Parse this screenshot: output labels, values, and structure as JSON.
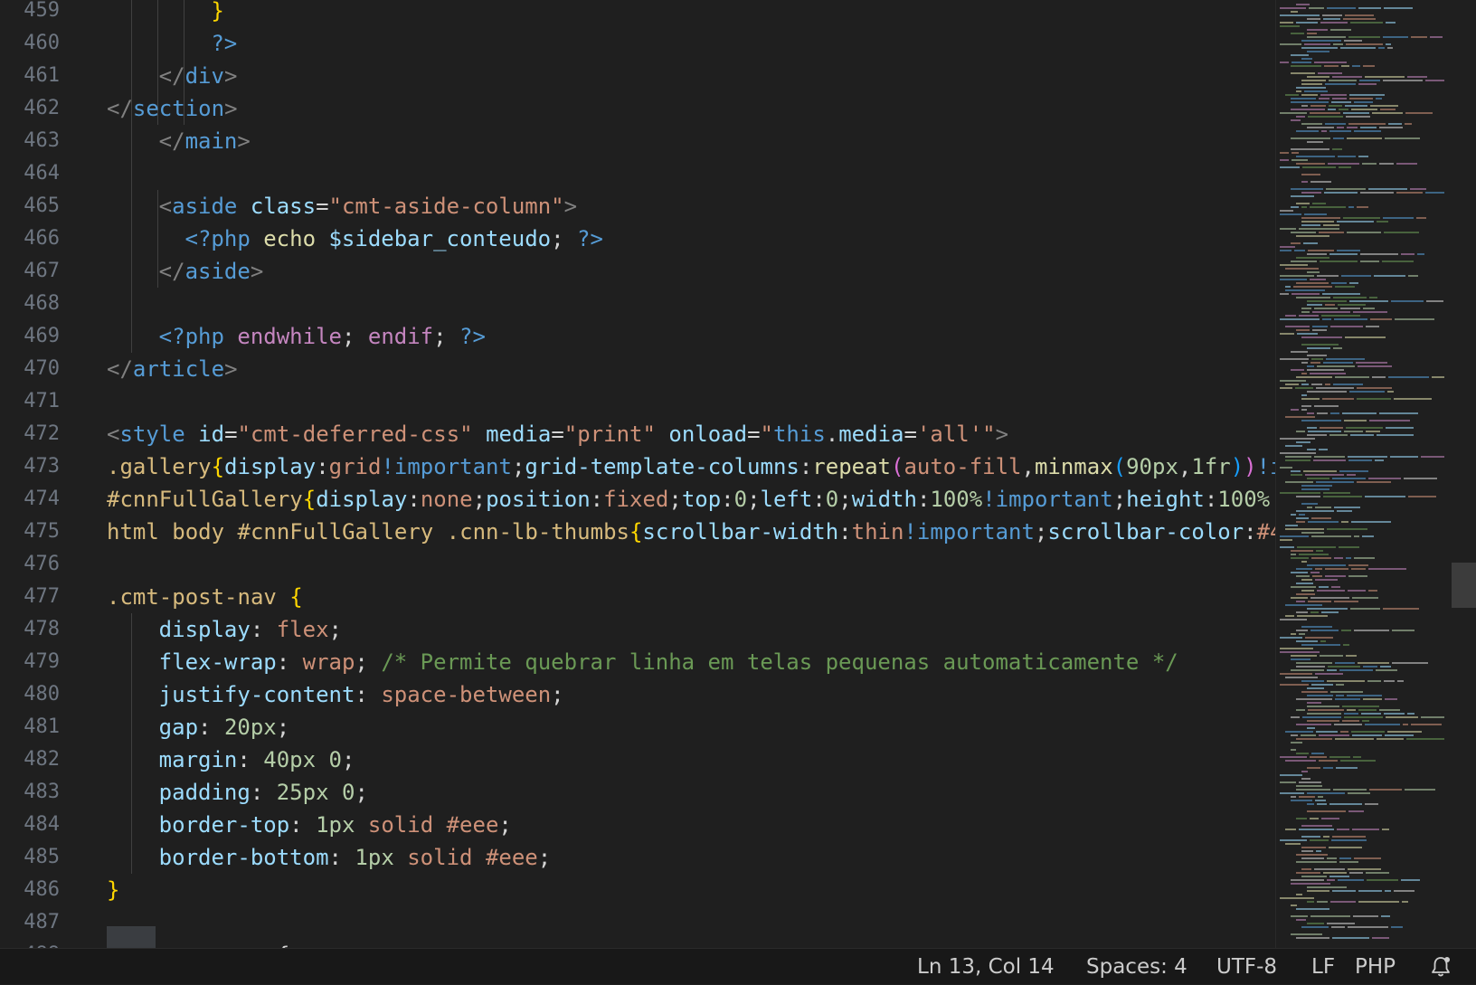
{
  "editor": {
    "line_numbers": [
      "459",
      "460",
      "461",
      "462",
      "463",
      "464",
      "465",
      "466",
      "467",
      "468",
      "469",
      "470",
      "471",
      "472",
      "473",
      "474",
      "475",
      "476",
      "477",
      "478",
      "479",
      "480",
      "481",
      "482",
      "483",
      "484",
      "485",
      "486",
      "487",
      "488"
    ],
    "lines": [
      [
        [
          "t-brace",
          "}"
        ]
      ],
      [
        [
          "t-php",
          "?>"
        ]
      ],
      [
        [
          "t-punc",
          "</"
        ],
        [
          "t-tag",
          "div"
        ],
        [
          "t-punc",
          ">"
        ]
      ],
      [
        [
          "t-punc",
          "</"
        ],
        [
          "t-tag",
          "section"
        ],
        [
          "t-punc",
          ">"
        ]
      ],
      [
        [
          "t-punc",
          "</"
        ],
        [
          "t-tag",
          "main"
        ],
        [
          "t-punc",
          ">"
        ]
      ],
      [],
      [
        [
          "t-punc",
          "<"
        ],
        [
          "t-tag",
          "aside"
        ],
        [
          "t-plain",
          " "
        ],
        [
          "t-attr",
          "class"
        ],
        [
          "t-plain",
          "="
        ],
        [
          "t-str",
          "\"cmt-aside-column\""
        ],
        [
          "t-punc",
          ">"
        ]
      ],
      [
        [
          "t-php",
          "<?php"
        ],
        [
          "t-plain",
          " "
        ],
        [
          "t-fn",
          "echo"
        ],
        [
          "t-plain",
          " "
        ],
        [
          "t-var",
          "$sidebar_conteudo"
        ],
        [
          "t-plain",
          "; "
        ],
        [
          "t-php",
          "?>"
        ]
      ],
      [
        [
          "t-punc",
          "</"
        ],
        [
          "t-tag",
          "aside"
        ],
        [
          "t-punc",
          ">"
        ]
      ],
      [],
      [
        [
          "t-php",
          "<?php"
        ],
        [
          "t-plain",
          " "
        ],
        [
          "t-kw",
          "endwhile"
        ],
        [
          "t-plain",
          "; "
        ],
        [
          "t-kw",
          "endif"
        ],
        [
          "t-plain",
          "; "
        ],
        [
          "t-php",
          "?>"
        ]
      ],
      [
        [
          "t-punc",
          "</"
        ],
        [
          "t-tag",
          "article"
        ],
        [
          "t-punc",
          ">"
        ]
      ],
      [],
      [
        [
          "t-punc",
          "<"
        ],
        [
          "t-tag",
          "style"
        ],
        [
          "t-plain",
          " "
        ],
        [
          "t-attr",
          "id"
        ],
        [
          "t-plain",
          "="
        ],
        [
          "t-str",
          "\"cmt-deferred-css\""
        ],
        [
          "t-plain",
          " "
        ],
        [
          "t-attr",
          "media"
        ],
        [
          "t-plain",
          "="
        ],
        [
          "t-str",
          "\"print\""
        ],
        [
          "t-plain",
          " "
        ],
        [
          "t-attr",
          "onload"
        ],
        [
          "t-plain",
          "="
        ],
        [
          "t-str",
          "\""
        ],
        [
          "t-this",
          "this"
        ],
        [
          "t-plain",
          "."
        ],
        [
          "t-attr",
          "media"
        ],
        [
          "t-plain",
          "="
        ],
        [
          "t-str",
          "'all'\""
        ],
        [
          "t-punc",
          ">"
        ]
      ],
      [
        [
          "t-sel",
          ".gallery"
        ],
        [
          "t-brace",
          "{"
        ],
        [
          "t-prop",
          "display"
        ],
        [
          "t-plain",
          ":"
        ],
        [
          "t-val",
          "grid"
        ],
        [
          "t-imp",
          "!important"
        ],
        [
          "t-plain",
          ";"
        ],
        [
          "t-prop",
          "grid-template-columns"
        ],
        [
          "t-plain",
          ":"
        ],
        [
          "t-fn",
          "repeat"
        ],
        [
          "t-paren",
          "("
        ],
        [
          "t-val",
          "auto-fill"
        ],
        [
          "t-plain",
          ","
        ],
        [
          "t-fn",
          "minmax"
        ],
        [
          "t-paren2",
          "("
        ],
        [
          "t-num",
          "90px"
        ],
        [
          "t-plain",
          ","
        ],
        [
          "t-num",
          "1fr"
        ],
        [
          "t-paren2",
          ")"
        ],
        [
          "t-paren",
          ")"
        ],
        [
          "t-imp",
          "!i"
        ]
      ],
      [
        [
          "t-sel",
          "#cnnFullGallery"
        ],
        [
          "t-brace",
          "{"
        ],
        [
          "t-prop",
          "display"
        ],
        [
          "t-plain",
          ":"
        ],
        [
          "t-val",
          "none"
        ],
        [
          "t-plain",
          ";"
        ],
        [
          "t-prop",
          "position"
        ],
        [
          "t-plain",
          ":"
        ],
        [
          "t-val",
          "fixed"
        ],
        [
          "t-plain",
          ";"
        ],
        [
          "t-prop",
          "top"
        ],
        [
          "t-plain",
          ":"
        ],
        [
          "t-num",
          "0"
        ],
        [
          "t-plain",
          ";"
        ],
        [
          "t-prop",
          "left"
        ],
        [
          "t-plain",
          ":"
        ],
        [
          "t-num",
          "0"
        ],
        [
          "t-plain",
          ";"
        ],
        [
          "t-prop",
          "width"
        ],
        [
          "t-plain",
          ":"
        ],
        [
          "t-num",
          "100%"
        ],
        [
          "t-imp",
          "!important"
        ],
        [
          "t-plain",
          ";"
        ],
        [
          "t-prop",
          "height"
        ],
        [
          "t-plain",
          ":"
        ],
        [
          "t-num",
          "100%"
        ]
      ],
      [
        [
          "t-sel",
          "html body #cnnFullGallery .cnn-lb-thumbs"
        ],
        [
          "t-brace",
          "{"
        ],
        [
          "t-prop",
          "scrollbar-width"
        ],
        [
          "t-plain",
          ":"
        ],
        [
          "t-val",
          "thin"
        ],
        [
          "t-imp",
          "!important"
        ],
        [
          "t-plain",
          ";"
        ],
        [
          "t-prop",
          "scrollbar-color"
        ],
        [
          "t-plain",
          ":"
        ],
        [
          "t-val",
          "#4"
        ]
      ],
      [],
      [
        [
          "t-sel",
          ".cmt-post-nav"
        ],
        [
          "t-plain",
          " "
        ],
        [
          "t-brace",
          "{"
        ]
      ],
      [
        [
          "t-prop",
          "display"
        ],
        [
          "t-plain",
          ": "
        ],
        [
          "t-val",
          "flex"
        ],
        [
          "t-plain",
          ";"
        ]
      ],
      [
        [
          "t-prop",
          "flex-wrap"
        ],
        [
          "t-plain",
          ": "
        ],
        [
          "t-val",
          "wrap"
        ],
        [
          "t-plain",
          "; "
        ],
        [
          "t-com",
          "/* Permite quebrar linha em telas pequenas automaticamente */"
        ]
      ],
      [
        [
          "t-prop",
          "justify-content"
        ],
        [
          "t-plain",
          ": "
        ],
        [
          "t-val",
          "space-between"
        ],
        [
          "t-plain",
          ";"
        ]
      ],
      [
        [
          "t-prop",
          "gap"
        ],
        [
          "t-plain",
          ": "
        ],
        [
          "t-num",
          "20px"
        ],
        [
          "t-plain",
          ";"
        ]
      ],
      [
        [
          "t-prop",
          "margin"
        ],
        [
          "t-plain",
          ": "
        ],
        [
          "t-num",
          "40px"
        ],
        [
          "t-plain",
          " "
        ],
        [
          "t-num",
          "0"
        ],
        [
          "t-plain",
          ";"
        ]
      ],
      [
        [
          "t-prop",
          "padding"
        ],
        [
          "t-plain",
          ": "
        ],
        [
          "t-num",
          "25px"
        ],
        [
          "t-plain",
          " "
        ],
        [
          "t-num",
          "0"
        ],
        [
          "t-plain",
          ";"
        ]
      ],
      [
        [
          "t-prop",
          "border-top"
        ],
        [
          "t-plain",
          ": "
        ],
        [
          "t-num",
          "1px"
        ],
        [
          "t-plain",
          " "
        ],
        [
          "t-val",
          "solid"
        ],
        [
          "t-plain",
          " "
        ],
        [
          "t-val",
          "#eee"
        ],
        [
          "t-plain",
          ";"
        ]
      ],
      [
        [
          "t-prop",
          "border-bottom"
        ],
        [
          "t-plain",
          ": "
        ],
        [
          "t-num",
          "1px"
        ],
        [
          "t-plain",
          " "
        ],
        [
          "t-val",
          "solid"
        ],
        [
          "t-plain",
          " "
        ],
        [
          "t-val",
          "#eee"
        ],
        [
          "t-plain",
          ";"
        ]
      ],
      [
        [
          "t-brace",
          "}"
        ]
      ],
      [],
      [
        [
          "t-cut",
          "  .   .   .  {"
        ]
      ]
    ]
  },
  "status_bar": {
    "position": "Ln 13, Col 14",
    "indentation": "Spaces: 4",
    "encoding": "UTF-8",
    "line_ending": "LF",
    "language": "PHP",
    "notification_icon": "bell-icon"
  },
  "colors": {
    "editor_bg": "#1f1f1f",
    "status_bg": "#181818",
    "line_number": "#6e7681"
  }
}
